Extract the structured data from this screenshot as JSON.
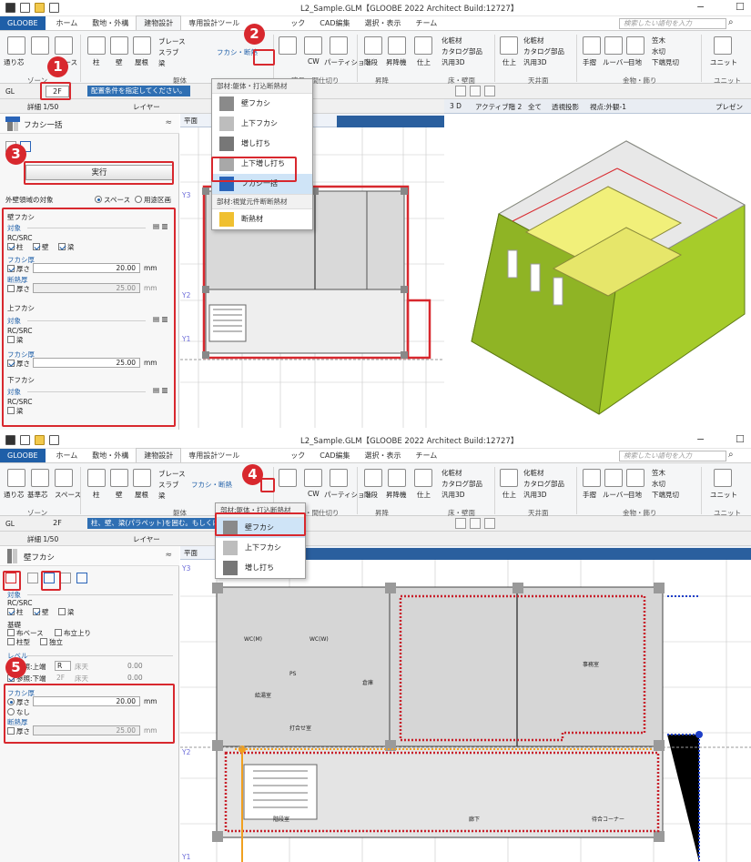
{
  "window": {
    "title": "L2_Sample.GLM【GLOOBE 2022 Architect Build:12727】",
    "min_glyph": "−",
    "max_glyph": "☐"
  },
  "tabs": [
    "GLOOBE",
    "ホーム",
    "敷地・外構",
    "建物設計",
    "専用設計ツール",
    "ック",
    "CAD編集",
    "選択・表示",
    "チーム"
  ],
  "search": {
    "placeholder": "検索したい語句を入力"
  },
  "ribbon": {
    "zone": {
      "labels": [
        "通り芯",
        "基準芯",
        "スペース"
      ],
      "group": "ゾーン"
    },
    "body": {
      "labels": [
        "柱",
        "壁",
        "屋根"
      ],
      "group": "躯体",
      "brace": "ブレース",
      "slab": "スラブ",
      "beam": "梁",
      "fukashi_dd": "フカシ・断熱"
    },
    "openings": {
      "labels": [
        "建具",
        "CW",
        "パーティション"
      ],
      "group": "建具・間仕切り"
    },
    "lift": {
      "labels": [
        "階段",
        "昇降機"
      ],
      "group": "昇降"
    },
    "finish": {
      "labels": [
        "仕上"
      ],
      "items": [
        "化粧材",
        "カタログ部品",
        "汎用3D"
      ],
      "group": "床・壁面"
    },
    "ceiling": {
      "labels": [
        "仕上"
      ],
      "items": [
        "化粧材",
        "カタログ部品",
        "汎用3D"
      ],
      "group": "天井面"
    },
    "hardware": {
      "labels": [
        "手摺",
        "ルーバー",
        "目地"
      ],
      "items": [
        "笠木",
        "水切",
        "下端見切"
      ],
      "group": "金物・飾り"
    },
    "unit": {
      "labels": [
        "ユニット"
      ],
      "group": "ユニット"
    }
  },
  "pane1": {
    "floor": "2F",
    "floor_prefix": "GL",
    "hint": "配置条件を指定してください。",
    "toolbar3": {
      "detail": "詳細 1/50",
      "layer": "レイヤー"
    },
    "plan_tab": "平面",
    "view3d_tabs": [
      "3 D",
      "アクティブ階 2",
      "全て",
      "透視投影",
      "視点:外観-1",
      "プレゼン"
    ],
    "grid_labels": [
      "Y3",
      "Y2",
      "Y1"
    ],
    "panel_title": "フカシ一括",
    "exec_label": "実行",
    "outer_target": "外壁領域の対象",
    "outer_opts": [
      "スペース",
      "用途区画"
    ],
    "wall_section": "壁フカシ",
    "target_label": "対象",
    "rcsrc": "RC/SRC",
    "wall_checks": [
      "柱",
      "壁",
      "梁"
    ],
    "fukashi_thick": "フカシ厚",
    "thick_label": "厚さ",
    "wall_thick_value": "20.00",
    "unit": "mm",
    "insulation": "断熱厚",
    "ins_value": "25.00",
    "upper_section": "上フカシ",
    "beam_label": "梁",
    "upper_thick_value": "25.00",
    "lower_section": "下フカシ",
    "menu_header": "部材:躯体・打込断熱材",
    "menu_items": [
      "壁フカシ",
      "上下フカシ",
      "増し打ち",
      "上下増し打ち",
      "フカシ一括",
      "断熱材"
    ],
    "menu_sub": "部材:視覚元件断断熱材",
    "badges": [
      "1",
      "2",
      "3"
    ]
  },
  "pane2": {
    "floor": "2F",
    "floor_prefix": "GL",
    "hint": "柱、壁、梁(パラペット)を囲む。もしくは",
    "toolbar3": {
      "detail": "詳細 1/50",
      "layer": "レイヤー"
    },
    "plan_tab": "平面",
    "grid_labels": [
      "Y3",
      "Y2",
      "Y1"
    ],
    "panel_title": "壁フカシ",
    "target_label": "対象",
    "rcsrc": "RC/SRC",
    "checks": [
      "柱",
      "壁",
      "梁"
    ],
    "base_label": "基礎",
    "base_checks": [
      "布ベース",
      "布立上り",
      "柱型",
      "独立"
    ],
    "level_label": "レベル",
    "level_rows": [
      {
        "label": "参照:上端",
        "ref": "R",
        "extra": "床天",
        "value": "0.00"
      },
      {
        "label": "参照:下端",
        "ref": "2F",
        "extra": "床天",
        "value": "0.00"
      }
    ],
    "fukashi_thick": "フカシ厚",
    "thick_label": "厚さ",
    "thick_value": "20.00",
    "none_label": "なし",
    "insulation": "断熱厚",
    "ins_value": "25.00",
    "unit": "mm",
    "menu_header": "部材:躯体・打込断熱材",
    "menu_items": [
      "壁フカシ",
      "上下フカシ",
      "増し打ち"
    ],
    "fukashi_dd": "フカシ・断熱",
    "rooms": [
      "WC(M)",
      "WC(W)",
      "PS",
      "給湯室",
      "打合せ室",
      "倉庫",
      "事務室",
      "階段室",
      "廊下",
      "待合コーナー"
    ],
    "badges": [
      "4",
      "5"
    ]
  },
  "colors": {
    "accent_red": "#d8282e",
    "app_blue": "#1f5fa8",
    "wall_green": "#a6cc2a",
    "dotted_red": "#c8202a",
    "dotted_orange": "#f0a020",
    "dotted_blue": "#1e3fc8"
  }
}
